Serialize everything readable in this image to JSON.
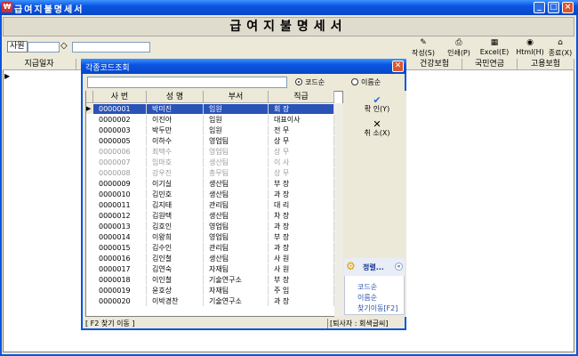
{
  "window": {
    "title": "급여지불명세서",
    "min": "_",
    "max": "□",
    "close": "×",
    "app_icon": "pay-app-icon"
  },
  "banner": "급여지불명세서",
  "toolbar": {
    "sawon_label": "사원",
    "items": [
      {
        "label": "작성(S)",
        "icon": "pencil-icon",
        "glyph": "✎"
      },
      {
        "label": "인쇄(P)",
        "icon": "printer-icon",
        "glyph": "⎙"
      },
      {
        "label": "Excel(E)",
        "icon": "excel-icon",
        "glyph": "▦"
      },
      {
        "label": "Html(H)",
        "icon": "globe-icon",
        "glyph": "◉"
      },
      {
        "label": "종료(X)",
        "icon": "home-icon",
        "glyph": "⌂"
      }
    ]
  },
  "grid": {
    "headers": [
      "지급일자",
      "",
      "",
      "",
      "",
      "",
      "",
      "",
      "",
      "건강보험",
      "국민연금",
      "고용보험"
    ]
  },
  "dialog": {
    "title": "각종코드조회",
    "search_value": "",
    "radio_code": "코드순",
    "radio_name": "이름순",
    "columns": [
      "사 번",
      "성 명",
      "부서",
      "직급"
    ],
    "rows": [
      [
        "0000001",
        "박미진",
        "임원",
        "회    장"
      ],
      [
        "0000002",
        "이진아",
        "임원",
        "대표이사"
      ],
      [
        "0000003",
        "박두만",
        "임원",
        "전    무"
      ],
      [
        "0000005",
        "이하수",
        "영업팀",
        "상    무"
      ],
      [
        "0000006",
        "최택수",
        "영업팀",
        "상    무"
      ],
      [
        "0000007",
        "임마호",
        "생산팀",
        "이    사"
      ],
      [
        "0000008",
        "강우진",
        "총무팀",
        "상    무"
      ],
      [
        "0000009",
        "이기실",
        "생산팀",
        "부    장"
      ],
      [
        "0000010",
        "김민호",
        "생산팀",
        "과    장"
      ],
      [
        "0000011",
        "김지태",
        "관리팀",
        "대    리"
      ],
      [
        "0000012",
        "김원택",
        "생산팀",
        "차    장"
      ],
      [
        "0000013",
        "김호인",
        "영업팀",
        "과    장"
      ],
      [
        "0000014",
        "이왕희",
        "영업팀",
        "부    장"
      ],
      [
        "0000015",
        "김수인",
        "관리팀",
        "과    장"
      ],
      [
        "0000016",
        "김인철",
        "생산팀",
        "사    원"
      ],
      [
        "0000017",
        "김연숙",
        "자재팀",
        "사    원"
      ],
      [
        "0000018",
        "이인철",
        "기술연구소",
        "부    장"
      ],
      [
        "0000019",
        "윤호상",
        "자재팀",
        "주    임"
      ],
      [
        "0000020",
        "이박경찬",
        "기술연구소",
        "과    장"
      ]
    ],
    "ok": "확 인(Y)",
    "cancel": "취 소(X)",
    "panel_title": "정렬...",
    "links": [
      "코드순",
      "이름순",
      "찾기이동[F2]"
    ],
    "status_left": "[ F2 찾기 이동 ]",
    "status_right": "[퇴사자 : 회색글씨]"
  }
}
